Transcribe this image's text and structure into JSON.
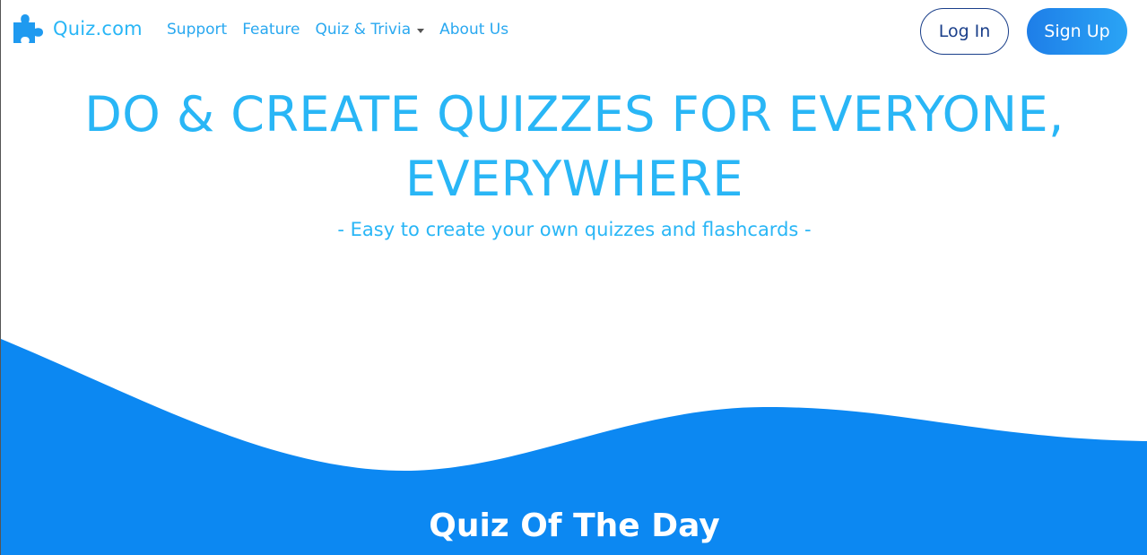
{
  "brand": {
    "name": "Quiz.com",
    "icon": "puzzle-piece-icon"
  },
  "nav": {
    "items": [
      {
        "label": "Support"
      },
      {
        "label": "Feature"
      },
      {
        "label": "Quiz & Trivia",
        "dropdown": true
      },
      {
        "label": "About Us"
      }
    ]
  },
  "auth": {
    "login_label": "Log In",
    "signup_label": "Sign Up"
  },
  "hero": {
    "title_line1": "DO & CREATE QUIZZES FOR EVERYONE,",
    "title_line2": "EVERYWHERE",
    "subtitle": "- Easy to create your own quizzes and flashcards -"
  },
  "section": {
    "title": "Quiz Of The Day"
  },
  "colors": {
    "accent": "#29b6f6",
    "wave": "#0c88f2",
    "login_border": "#1a3f8a"
  }
}
